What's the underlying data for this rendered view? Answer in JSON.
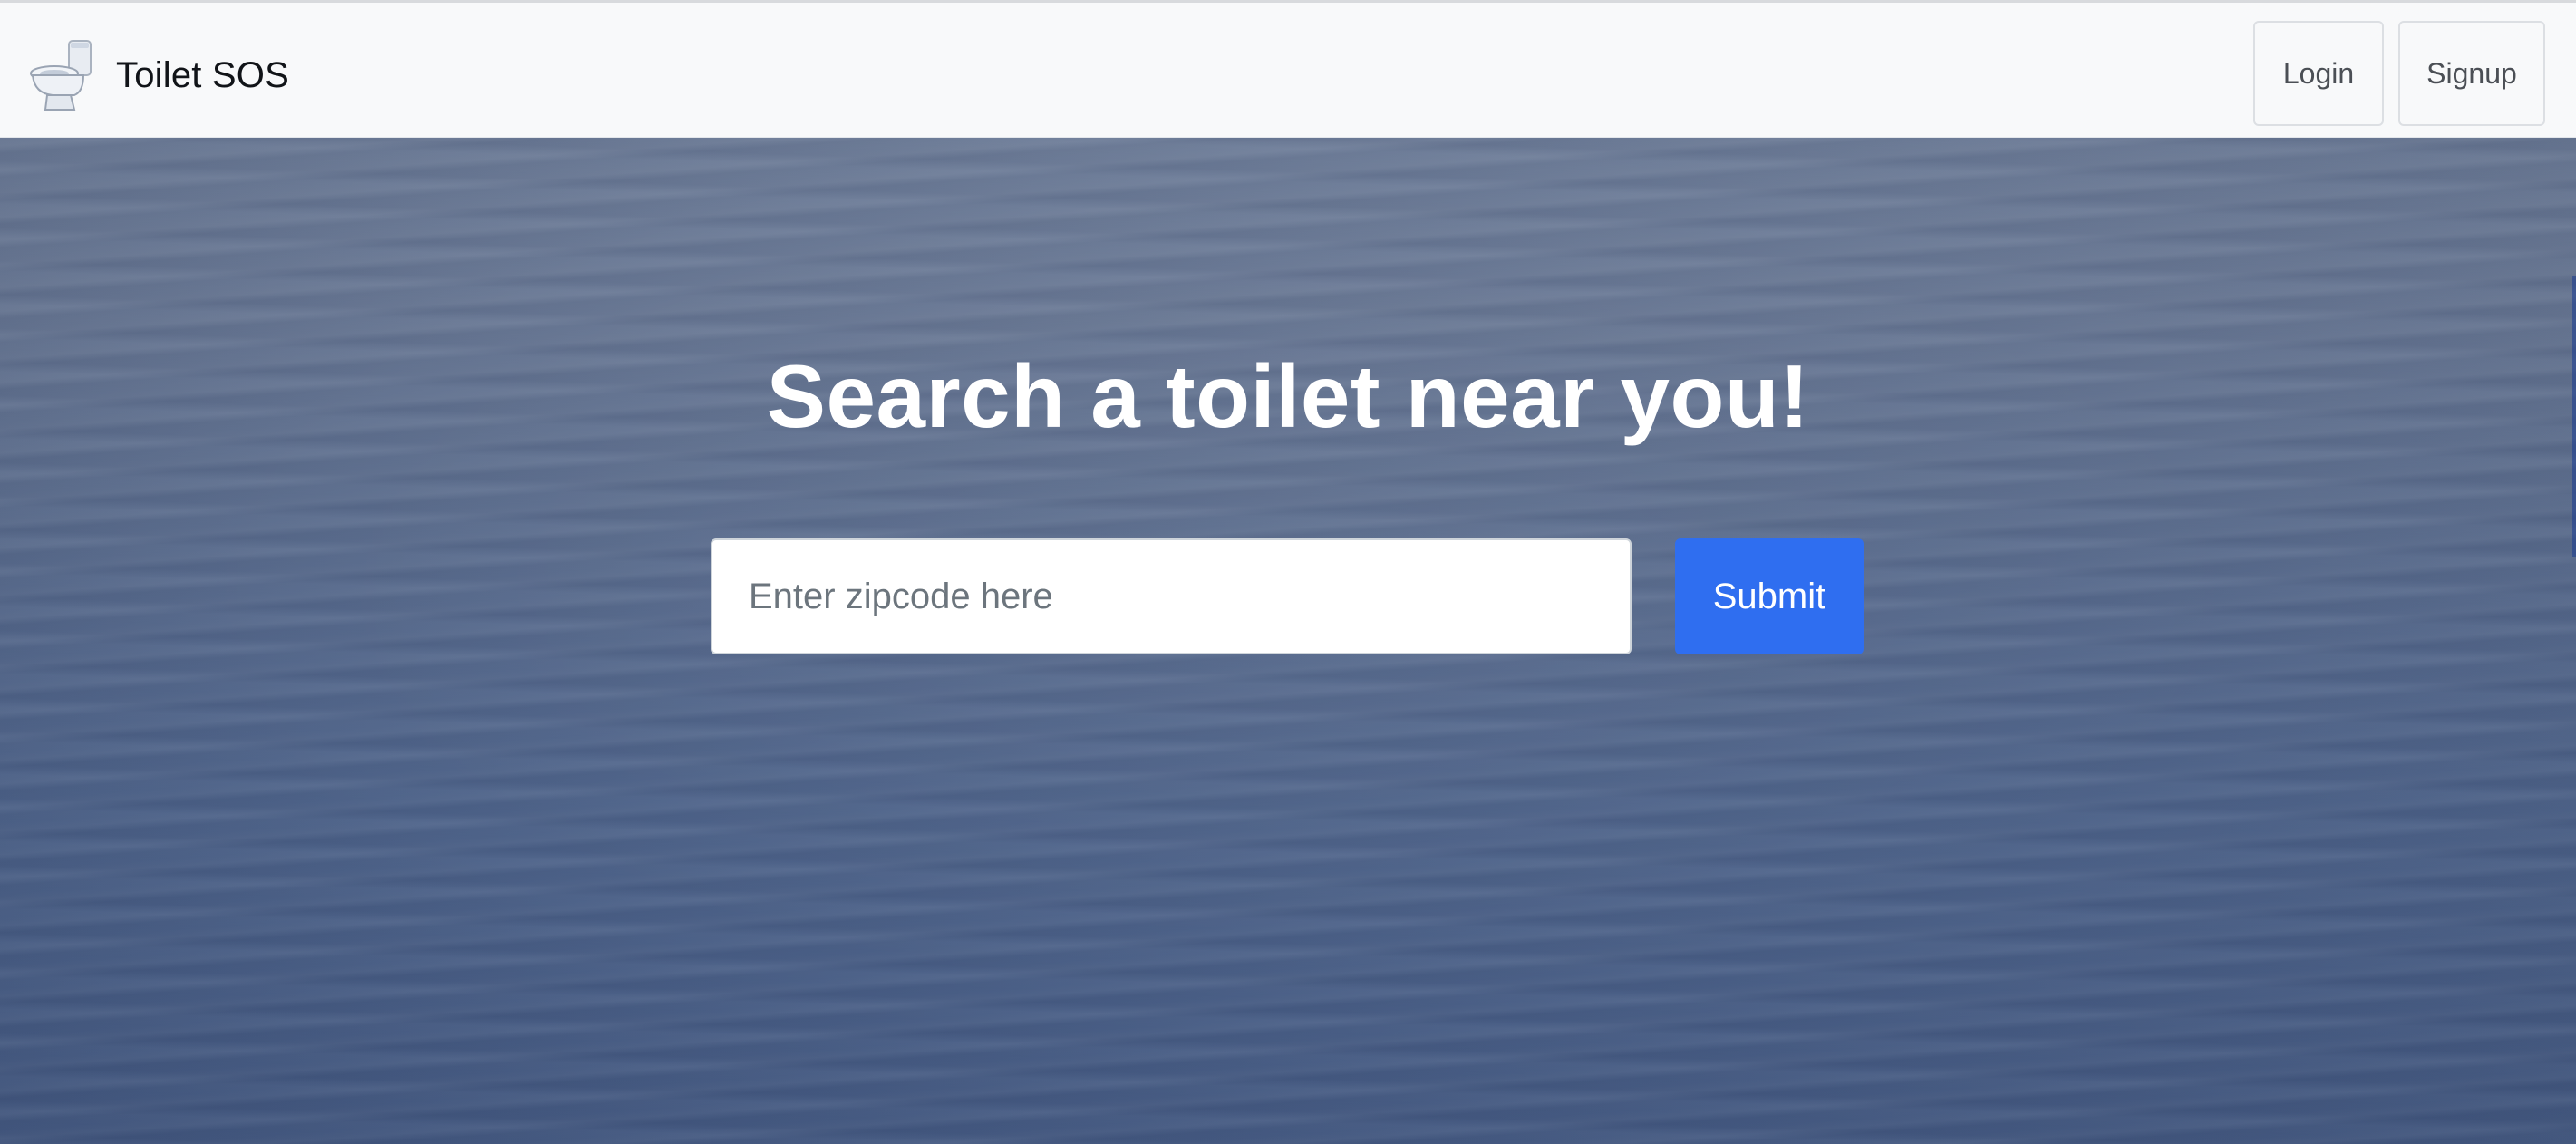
{
  "app": {
    "brand_name": "Toilet SOS",
    "brand_icon": "toilet-icon"
  },
  "navbar": {
    "login_label": "Login",
    "signup_label": "Signup"
  },
  "hero": {
    "title": "Search a toilet near you!",
    "search": {
      "placeholder": "Enter zipcode here",
      "value": ""
    },
    "submit_label": "Submit"
  },
  "colors": {
    "navbar_bg": "#f8f9fa",
    "submit_bg": "#2f6ef0",
    "hero_top": "#6e7d98",
    "hero_bottom": "#465b83",
    "title_text": "#ffffff"
  }
}
